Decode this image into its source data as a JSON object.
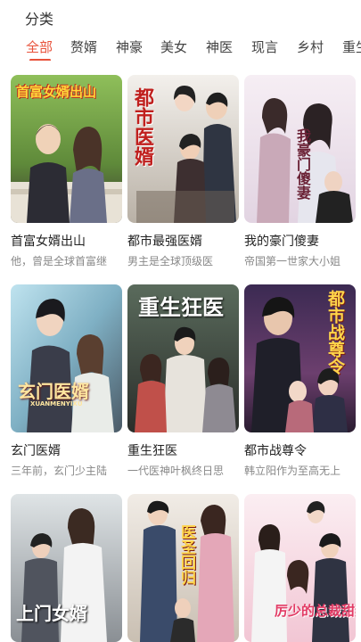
{
  "header": {
    "title": "分类"
  },
  "tabs": [
    {
      "label": "全部",
      "active": true
    },
    {
      "label": "赘婿",
      "active": false
    },
    {
      "label": "神豪",
      "active": false
    },
    {
      "label": "美女",
      "active": false
    },
    {
      "label": "神医",
      "active": false
    },
    {
      "label": "现言",
      "active": false
    },
    {
      "label": "乡村",
      "active": false
    },
    {
      "label": "重生",
      "active": false
    }
  ],
  "colors": {
    "accent": "#e8513a"
  },
  "dramas": [
    {
      "name": "首富女婿出山",
      "desc": "他，曾是全球首富继",
      "poster_title": "首富女婿出山"
    },
    {
      "name": "都市最强医婿",
      "desc": "男主是全球顶级医",
      "poster_title": "都市医婿"
    },
    {
      "name": "我的豪门傻妻",
      "desc": "帝国第一世家大小姐",
      "poster_title": "我豪门傻妻"
    },
    {
      "name": "玄门医婿",
      "desc": "三年前，玄门少主陆",
      "poster_title": "玄门医婿",
      "poster_subtitle": "XUANMENYIXU"
    },
    {
      "name": "重生狂医",
      "desc": "一代医神叶枫终日思",
      "poster_title": "重生狂医"
    },
    {
      "name": "都市战尊令",
      "desc": "韩立阳作为至高无上",
      "poster_title": "都市战尊令"
    },
    {
      "name": "",
      "desc": "",
      "poster_title": "上门女婿"
    },
    {
      "name": "",
      "desc": "",
      "poster_title": "医圣回归"
    },
    {
      "name": "",
      "desc": "",
      "poster_title": "厉少的总裁甜妻"
    }
  ]
}
